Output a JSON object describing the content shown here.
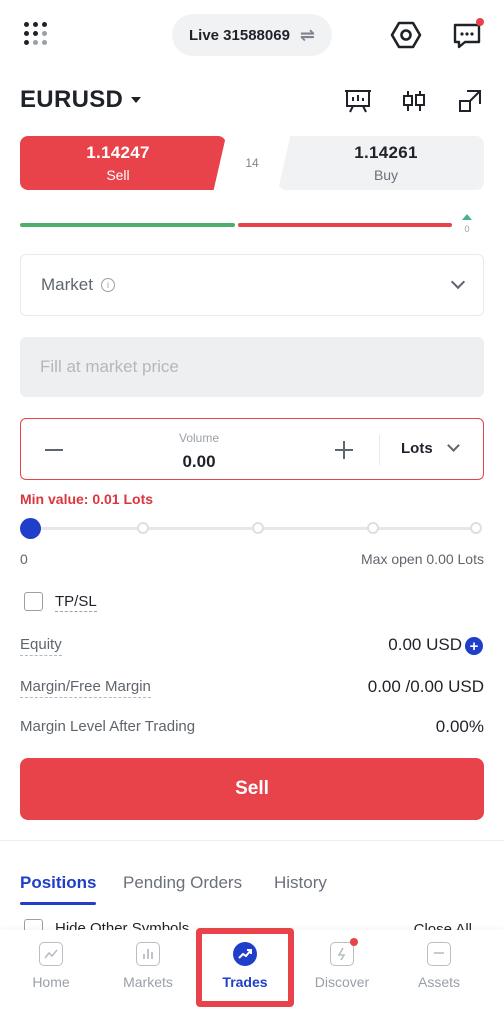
{
  "header": {
    "account": "Live 31588069",
    "swap_icon": "⇌"
  },
  "symbol": {
    "name": "EURUSD"
  },
  "prices": {
    "sell_price": "1.14247",
    "sell_label": "Sell",
    "spread": "14",
    "buy_price": "1.14261",
    "buy_label": "Buy",
    "sentiment_value": "0"
  },
  "order": {
    "type": "Market",
    "price_placeholder": "Fill at market price",
    "volume_caption": "Volume",
    "volume_value": "0.00",
    "unit": "Lots",
    "error": "Min value: 0.01 Lots",
    "slider_min": "0",
    "slider_max": "Max open 0.00 Lots",
    "slider_level": 0,
    "tpsl_label": "TP/SL"
  },
  "summary": {
    "equity_label": "Equity",
    "equity_value": "0.00 USD",
    "margin_label": "Margin/Free Margin",
    "margin_value": "0.00 /0.00 USD",
    "level_label": "Margin Level After Trading",
    "level_value": "0.00%"
  },
  "actions": {
    "sell_button": "Sell"
  },
  "position_tabs": {
    "positions": "Positions",
    "pending": "Pending Orders",
    "history": "History",
    "active": "Positions"
  },
  "position_filters": {
    "hide_other": "Hide Other Symbols",
    "close_all": "Close All"
  },
  "bottom_nav": {
    "items": [
      {
        "label": "Home",
        "icon": "home-chart-icon"
      },
      {
        "label": "Markets",
        "icon": "markets-bars-icon"
      },
      {
        "label": "Trades",
        "icon": "trades-trend-icon"
      },
      {
        "label": "Discover",
        "icon": "discover-lightning-icon"
      },
      {
        "label": "Assets",
        "icon": "assets-wallet-icon"
      }
    ],
    "active": "Trades"
  },
  "colors": {
    "sell": "#e8424a",
    "buy_bg": "#f1f2f4",
    "accent": "#1f3ec9",
    "positive": "#4caf6d"
  }
}
